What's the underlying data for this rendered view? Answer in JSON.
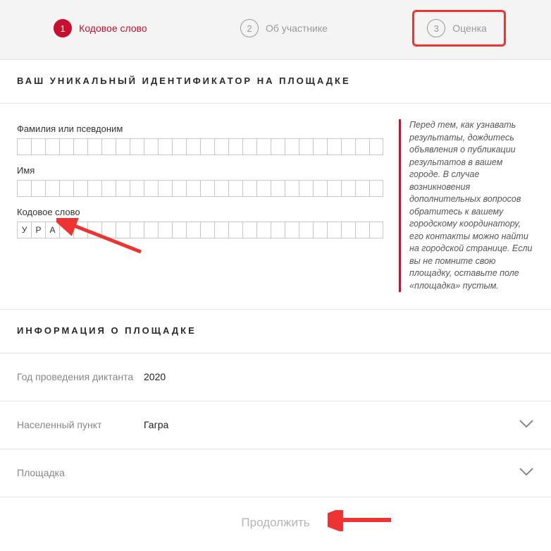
{
  "steps": {
    "s1": {
      "num": "1",
      "label": "Кодовое слово"
    },
    "s2": {
      "num": "2",
      "label": "Об участнике"
    },
    "s3": {
      "num": "3",
      "label": "Оценка"
    }
  },
  "id_section_title": "ВАШ УНИКАЛЬНЫЙ ИДЕНТИФИКАТОР НА ПЛОЩАДКЕ",
  "fields": {
    "surname_label": "Фамилия или псевдоним",
    "name_label": "Имя",
    "codeword_label": "Кодовое слово",
    "codeword_value": [
      "У",
      "Р",
      "А",
      "",
      "",
      "",
      "",
      "",
      "",
      "",
      "",
      "",
      "",
      "",
      "",
      "",
      "",
      "",
      "",
      "",
      "",
      "",
      "",
      "",
      "",
      ""
    ]
  },
  "hint": "Перед тем, как узнавать результаты, дождитесь объявления о публикации результатов в вашем городе. В случае возникновения дополнительных вопросов обратитесь к вашему городскому координатору, его контакты можно найти на городской странице. Если вы не помните свою площадку, оставьте поле «площадка» пустым.",
  "venue_section_title": "ИНФОРМАЦИЯ О ПЛОЩАДКЕ",
  "venue": {
    "year_label": "Год проведения диктанта",
    "year_value": "2020",
    "city_label": "Населенный пункт",
    "city_value": "Гагра",
    "place_label": "Площадка",
    "place_value": ""
  },
  "continue_label": "Продолжить"
}
